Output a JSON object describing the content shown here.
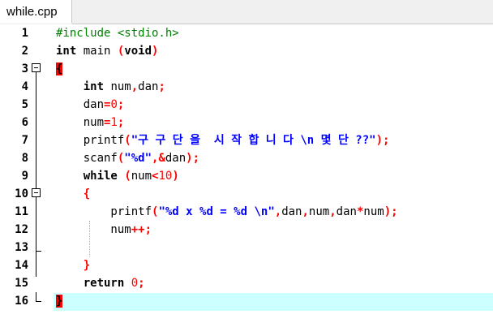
{
  "tab": {
    "title": "while.cpp"
  },
  "lines": [
    {
      "n": "1",
      "code": [
        [
          "pp",
          "#include <stdio.h>"
        ]
      ]
    },
    {
      "n": "2",
      "code": [
        [
          "kw",
          "int"
        ],
        [
          "",
          " main "
        ],
        [
          "br",
          "("
        ],
        [
          "kw",
          "void"
        ],
        [
          "br",
          ")"
        ]
      ]
    },
    {
      "n": "3",
      "code": [
        [
          "mk",
          "{"
        ]
      ]
    },
    {
      "n": "4",
      "code": [
        [
          "",
          "    "
        ],
        [
          "kw",
          "int"
        ],
        [
          "",
          " num"
        ],
        [
          "op",
          ","
        ],
        [
          "",
          "dan"
        ],
        [
          "op",
          ";"
        ]
      ]
    },
    {
      "n": "5",
      "code": [
        [
          "",
          "    dan"
        ],
        [
          "op",
          "="
        ],
        [
          "nm",
          "0"
        ],
        [
          "op",
          ";"
        ]
      ]
    },
    {
      "n": "6",
      "code": [
        [
          "",
          "    num"
        ],
        [
          "op",
          "="
        ],
        [
          "nm",
          "1"
        ],
        [
          "op",
          ";"
        ]
      ]
    },
    {
      "n": "7",
      "code": [
        [
          "",
          "    printf"
        ],
        [
          "br",
          "("
        ],
        [
          "st",
          "\"구 구 단 을  시 작 합 니 다 \\n 몇 단 ??\""
        ],
        [
          "br",
          ")"
        ],
        [
          "op",
          ";"
        ]
      ]
    },
    {
      "n": "8",
      "code": [
        [
          "",
          "    scanf"
        ],
        [
          "br",
          "("
        ],
        [
          "st",
          "\"%d\""
        ],
        [
          "op",
          ",&"
        ],
        [
          "",
          "dan"
        ],
        [
          "br",
          ")"
        ],
        [
          "op",
          ";"
        ]
      ]
    },
    {
      "n": "9",
      "code": [
        [
          "",
          "    "
        ],
        [
          "kw",
          "while"
        ],
        [
          "",
          " "
        ],
        [
          "br",
          "("
        ],
        [
          "",
          "num"
        ],
        [
          "op",
          "<"
        ],
        [
          "nm",
          "10"
        ],
        [
          "br",
          ")"
        ]
      ]
    },
    {
      "n": "10",
      "code": [
        [
          "",
          "    "
        ],
        [
          "br",
          "{"
        ]
      ]
    },
    {
      "n": "11",
      "code": [
        [
          "",
          "        printf"
        ],
        [
          "br",
          "("
        ],
        [
          "st",
          "\"%d x %d = %d \\n\""
        ],
        [
          "op",
          ","
        ],
        [
          "",
          "dan"
        ],
        [
          "op",
          ","
        ],
        [
          "",
          "num"
        ],
        [
          "op",
          ","
        ],
        [
          "",
          "dan"
        ],
        [
          "op",
          "*"
        ],
        [
          "",
          "num"
        ],
        [
          "br",
          ")"
        ],
        [
          "op",
          ";"
        ]
      ]
    },
    {
      "n": "12",
      "code": [
        [
          "",
          "        num"
        ],
        [
          "op",
          "++;"
        ]
      ]
    },
    {
      "n": "13",
      "code": []
    },
    {
      "n": "14",
      "code": [
        [
          "",
          "    "
        ],
        [
          "br",
          "}"
        ]
      ]
    },
    {
      "n": "15",
      "code": [
        [
          "",
          "    "
        ],
        [
          "kw",
          "return"
        ],
        [
          "",
          " "
        ],
        [
          "nm",
          "0"
        ],
        [
          "op",
          ";"
        ]
      ]
    },
    {
      "n": "16",
      "code": [
        [
          "mk",
          "}"
        ]
      ],
      "current": true
    }
  ]
}
